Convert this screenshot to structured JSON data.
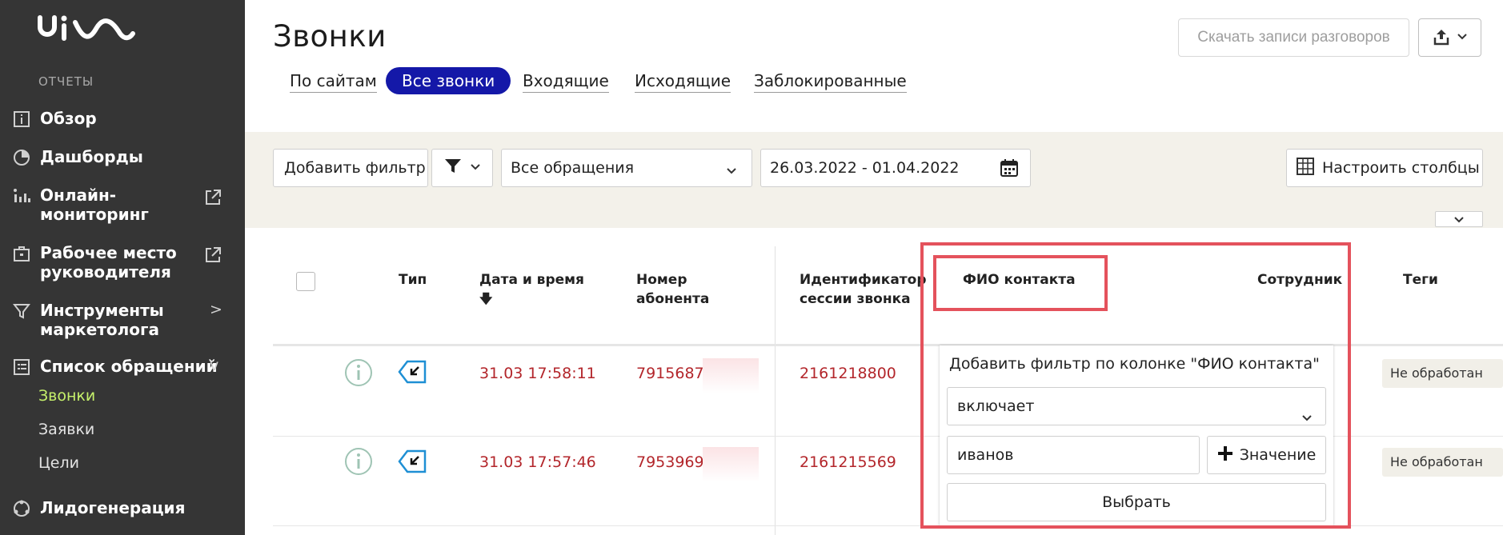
{
  "sidebar": {
    "logo_text": "uis",
    "section_label": "ОТЧЕТЫ",
    "items": [
      {
        "label": "Обзор"
      },
      {
        "label": "Дашборды"
      },
      {
        "label": "Онлайн-\nмониторинг"
      },
      {
        "label": "Рабочее место руководителя"
      },
      {
        "label": "Инструменты маркетолога",
        "arrow": ">"
      },
      {
        "label": "Список обращений",
        "arrow": "v"
      },
      {
        "label": "Лидогенерация"
      }
    ],
    "sub_items": [
      {
        "label": "Звонки"
      },
      {
        "label": "Заявки"
      },
      {
        "label": "Цели"
      }
    ]
  },
  "page": {
    "title": "Звонки",
    "tabs": [
      {
        "label": "По сайтам"
      },
      {
        "label": "Все звонки"
      },
      {
        "label": "Входящие"
      },
      {
        "label": "Исходящие"
      },
      {
        "label": "Заблокированные"
      }
    ],
    "download_label": "Скачать записи разговоров"
  },
  "filters": {
    "add_filter_label": "Добавить фильтр",
    "requests_select": "Все обращения",
    "date_range": "26.03.2022 - 01.04.2022",
    "configure_columns": "Настроить столбцы"
  },
  "table": {
    "columns": {
      "type": "Тип",
      "datetime": "Дата и время",
      "sort_arrow": "🡇",
      "number": "Номер абонента",
      "session": "Идентификатор сессии звонка",
      "contact": "ФИО контакта",
      "employee": "Сотрудник",
      "tags": "Теги"
    },
    "rows": [
      {
        "datetime": "31.03 17:58:11",
        "number": "7915687€",
        "session": "2161218800",
        "tag": "Не обработан"
      },
      {
        "datetime": "31.03 17:57:46",
        "number": "7953969",
        "session": "2161215569",
        "tag": "Не обработан"
      }
    ]
  },
  "popup": {
    "title": "Добавить фильтр по колонке \"ФИО контакта\"",
    "condition": "включает",
    "value": "иванов",
    "add_value_label": "Значение",
    "choose_label": "Выбрать"
  },
  "colors": {
    "sidebar_bg": "#353535",
    "active_tab": "#1418a8",
    "highlight": "#e4525c",
    "link_red": "#b3262b",
    "active_sub": "#c6f06b"
  }
}
